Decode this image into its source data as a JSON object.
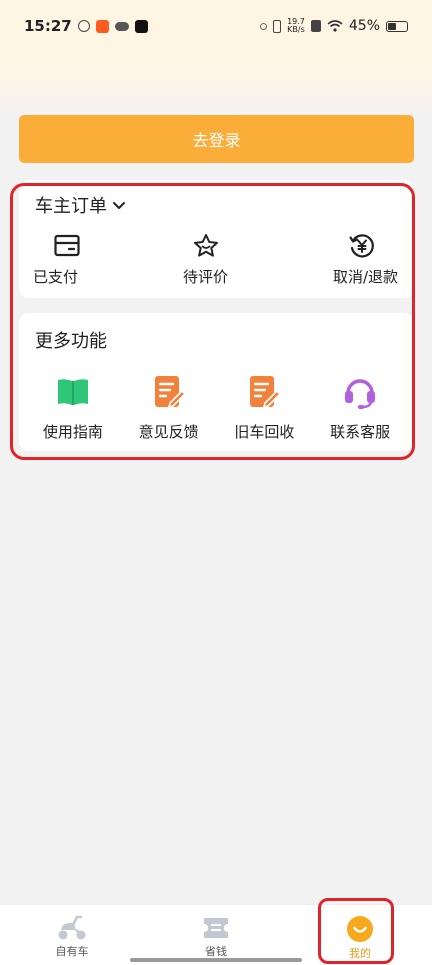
{
  "status_bar": {
    "time": "15:27",
    "net_speed_top": "19.7",
    "net_speed_bottom": "KB/s",
    "battery": "45%"
  },
  "login": {
    "label": "去登录"
  },
  "orders": {
    "title": "车主订单",
    "items": [
      {
        "label": "已支付",
        "icon": "card-icon"
      },
      {
        "label": "待评价",
        "icon": "star-icon"
      },
      {
        "label": "取消/退款",
        "icon": "yen-refund-icon"
      }
    ]
  },
  "more_features": {
    "title": "更多功能",
    "items": [
      {
        "label": "使用指南",
        "icon": "book-icon",
        "color": "#2fc67a"
      },
      {
        "label": "意见反馈",
        "icon": "feedback-icon",
        "color": "#f2813b"
      },
      {
        "label": "旧车回收",
        "icon": "recycle-doc-icon",
        "color": "#f2813b"
      },
      {
        "label": "联系客服",
        "icon": "headset-icon",
        "color": "#b15fe0"
      }
    ]
  },
  "tab_bar": {
    "items": [
      {
        "label": "自有车",
        "icon": "scooter-icon"
      },
      {
        "label": "省钱",
        "icon": "coupon-icon"
      },
      {
        "label": "我的",
        "icon": "smile-icon",
        "active": true
      }
    ]
  },
  "colors": {
    "accent": "#fbad3a",
    "highlight": "#e0242a",
    "active_tab": "#e79a1e"
  }
}
